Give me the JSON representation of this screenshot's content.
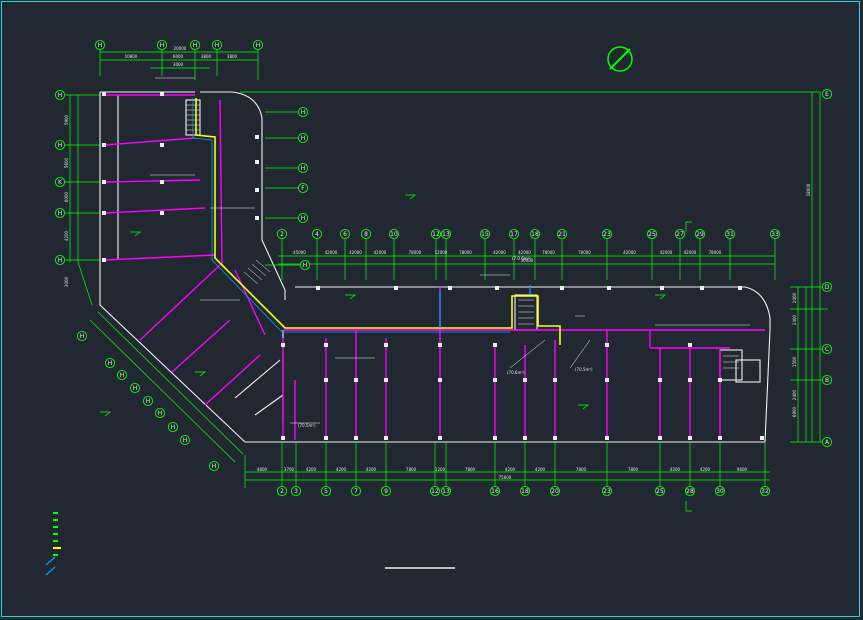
{
  "colors": {
    "background": "#222831",
    "frame": "#1fd5e0",
    "wall": "#f0f0f0",
    "grid_line": "#00ff00",
    "partition": "#ff00ff",
    "pipe": "#ffff00",
    "riser": "#00a0ff"
  },
  "compass": {
    "icon": "north-arrow-icon"
  },
  "top_axes": {
    "bottom_row": [
      "2",
      "3",
      "5",
      "7",
      "9",
      "12",
      "13",
      "16",
      "18",
      "20",
      "23",
      "25",
      "28",
      "30",
      "32"
    ],
    "bottom_dims": [
      "4800",
      "3700",
      "4200",
      "4200",
      "4200",
      "7800",
      "1200",
      "7800",
      "4200",
      "4200",
      "7800",
      "7800",
      "4200",
      "4200",
      "9600"
    ],
    "bottom_total": "75600",
    "upper_row": [
      "2",
      "4",
      "6",
      "8",
      "10",
      "12",
      "13",
      "15",
      "17",
      "18",
      "21",
      "23",
      "25",
      "27",
      "29",
      "31",
      "33"
    ],
    "upper_dims": [
      "45000",
      "42000",
      "42000",
      "42000",
      "78000",
      "12000",
      "78000",
      "42000",
      "42000",
      "78000",
      "78000",
      "42000",
      "42000",
      "42000",
      "78000"
    ],
    "upper_total": "30000",
    "right_rows": [
      "E",
      "D",
      "C",
      "B",
      "A"
    ],
    "right_dims": [
      "2400",
      "2400",
      "1500",
      "2400",
      "6800"
    ],
    "right_total": "18000",
    "top_left_marks": [
      "H",
      "H",
      "H",
      "H",
      "H"
    ],
    "top_left_dims": [
      "10800",
      "6000",
      "3800",
      "3800",
      "3000",
      "20000"
    ],
    "left_marks": [
      "H",
      "H",
      "K",
      "H",
      "H"
    ],
    "left_dims": [
      "5900",
      "5600",
      "6000",
      "4200",
      "3000"
    ],
    "diagonal_marks": [
      "H",
      "H",
      "H",
      "H",
      "H",
      "H",
      "H",
      "H",
      "H"
    ],
    "mid_marks": [
      "H",
      "H",
      "H",
      "F",
      "H",
      "H"
    ]
  },
  "room_notes": {
    "main_left": "(70.5m²)",
    "center": "(70.6m²)",
    "right": "(70.5m²)",
    "stair": "(7.0 6m²)"
  },
  "legend_items": 7
}
